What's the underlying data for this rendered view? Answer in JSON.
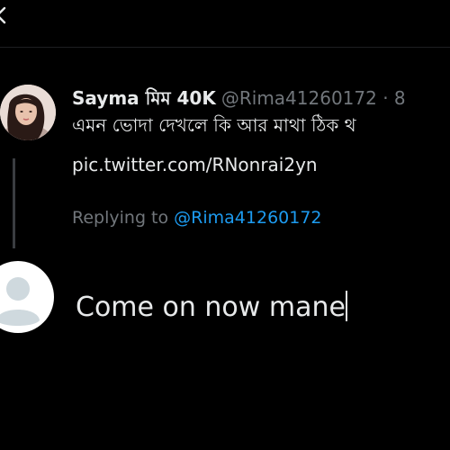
{
  "nav": {
    "back_icon": "chevron-left-icon"
  },
  "tweet": {
    "author_name": "Sayma মিম 40K",
    "author_handle": "@Rima41260172 · 8",
    "text": "এমন ভোদা দেখলে কি আর মাথা ঠিক থ",
    "link": "pic.twitter.com/RNonrai2yn",
    "avatar_icon": "user-avatar-photo"
  },
  "reply": {
    "replying_prefix": "Replying to",
    "replying_handle": "@Rima41260172",
    "avatar_icon": "default-avatar-icon",
    "composer_text": "Come on now mane"
  },
  "colors": {
    "background": "#000000",
    "text": "#e7e9ea",
    "muted": "#71767b",
    "accent": "#1d9bf0"
  }
}
